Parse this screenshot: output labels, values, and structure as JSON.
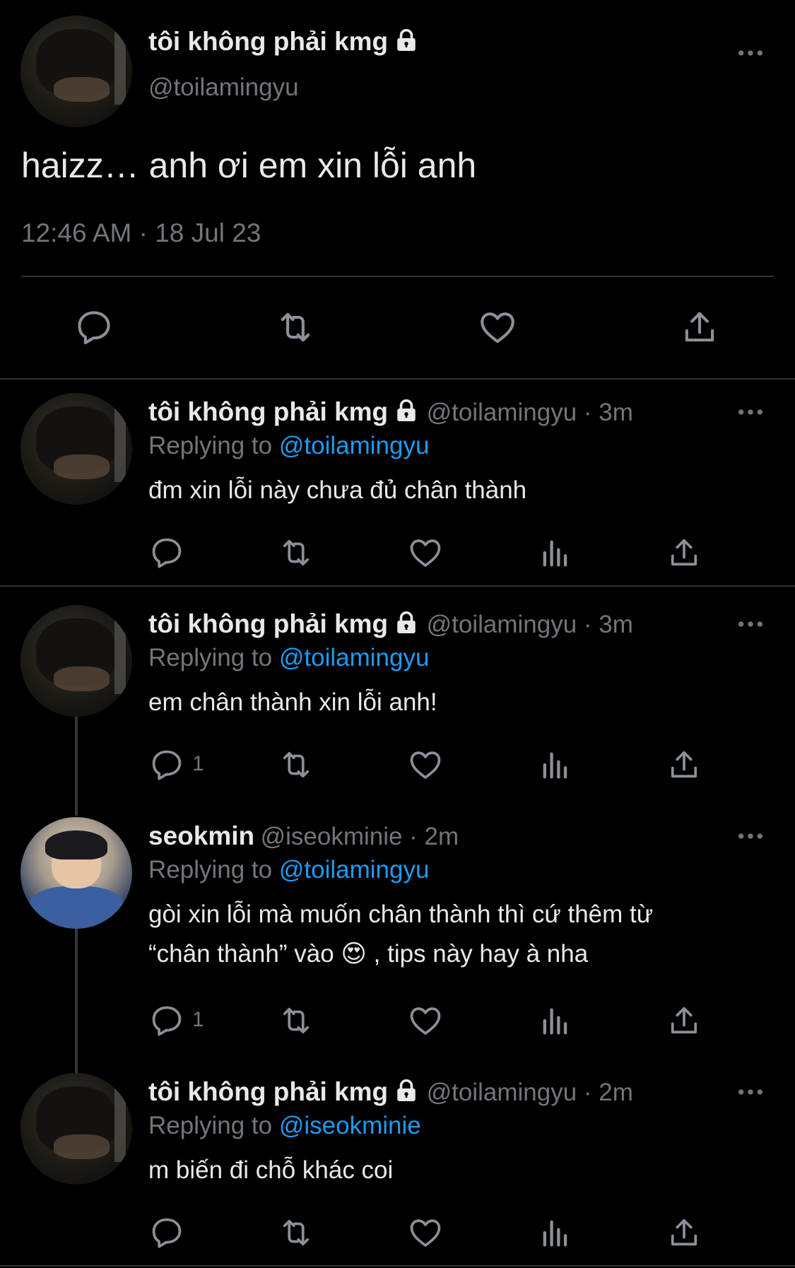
{
  "main_tweet": {
    "name": "tôi không phải kmg",
    "handle": "@toilamingyu",
    "text": "haizz… anh ơi em xin lỗi anh",
    "timestamp": "12:46 AM · 18 Jul 23"
  },
  "replies": [
    {
      "name": "tôi không phải kmg",
      "handle_time": "@toilamingyu · 3m",
      "replying_label": "Replying to",
      "replying_to": "@toilamingyu",
      "text": "đm xin lỗi này chưa đủ chân thành",
      "reply_count": ""
    },
    {
      "name": "tôi không phải kmg",
      "handle_time": "@toilamingyu · 3m",
      "replying_label": "Replying to",
      "replying_to": "@toilamingyu",
      "text": "em chân thành xin lỗi anh!",
      "reply_count": "1"
    },
    {
      "name": "seokmin",
      "handle_time": "@iseokminie · 2m",
      "replying_label": "Replying to",
      "replying_to": "@toilamingyu",
      "text_line1": "gòi xin lỗi mà muốn chân thành thì cứ thêm từ",
      "text_line2_a": "“chân thành” vào",
      "emoji": "😍",
      "text_line2_b": ", tips này hay à nha",
      "reply_count": "1"
    },
    {
      "name": "tôi không phải kmg",
      "handle_time": "@toilamingyu · 2m",
      "replying_label": "Replying to",
      "replying_to": "@iseokminie",
      "text": "m biến đi chỗ khác coi",
      "reply_count": ""
    }
  ],
  "colors": {
    "background": "#000000",
    "text": "#e7e9ea",
    "muted": "#71767b",
    "accent": "#1d9bf0"
  },
  "icons": [
    "lock-icon",
    "more-icon",
    "reply-icon",
    "retweet-icon",
    "like-icon",
    "share-icon",
    "views-icon"
  ]
}
